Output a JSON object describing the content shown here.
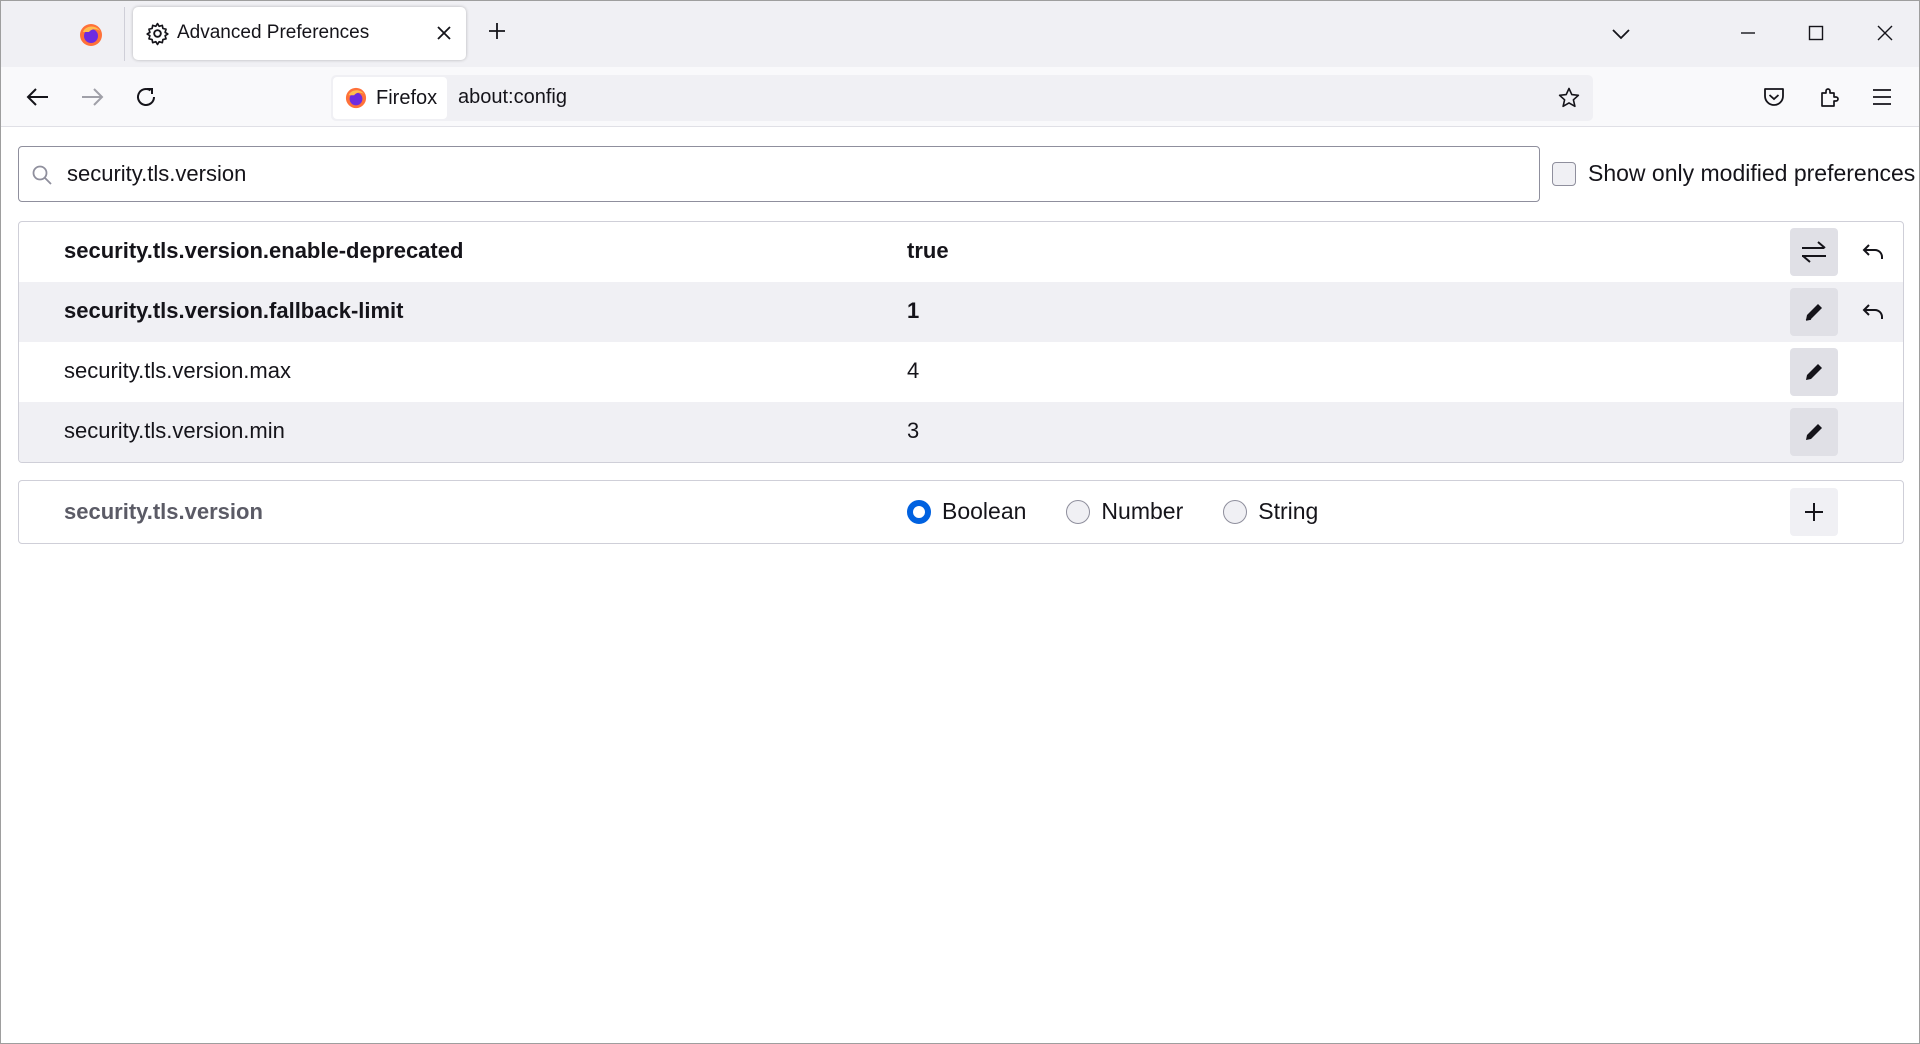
{
  "tabs": [
    {
      "title": "Advanced Preferences",
      "icon": "gear-icon",
      "active": true
    }
  ],
  "toolbar": {
    "identity_label": "Firefox",
    "url": "about:config"
  },
  "search": {
    "value": "security.tls.version"
  },
  "filter": {
    "modified_label": "Show only modified preferences",
    "checked": false
  },
  "prefs": [
    {
      "name": "security.tls.version.enable-deprecated",
      "value": "true",
      "modified": true,
      "action": "toggle-icon",
      "reset": true
    },
    {
      "name": "security.tls.version.fallback-limit",
      "value": "1",
      "modified": true,
      "action": "edit-icon",
      "reset": true
    },
    {
      "name": "security.tls.version.max",
      "value": "4",
      "modified": false,
      "action": "edit-icon",
      "reset": false
    },
    {
      "name": "security.tls.version.min",
      "value": "3",
      "modified": false,
      "action": "edit-icon",
      "reset": false
    }
  ],
  "new_pref": {
    "name": "security.tls.version",
    "types": [
      {
        "label": "Boolean",
        "checked": true
      },
      {
        "label": "Number",
        "checked": false
      },
      {
        "label": "String",
        "checked": false
      }
    ]
  },
  "colors": {
    "accent": "#0061e0",
    "tabstrip_bg": "#f0f0f4",
    "row_alt_bg": "#f0f0f4"
  }
}
